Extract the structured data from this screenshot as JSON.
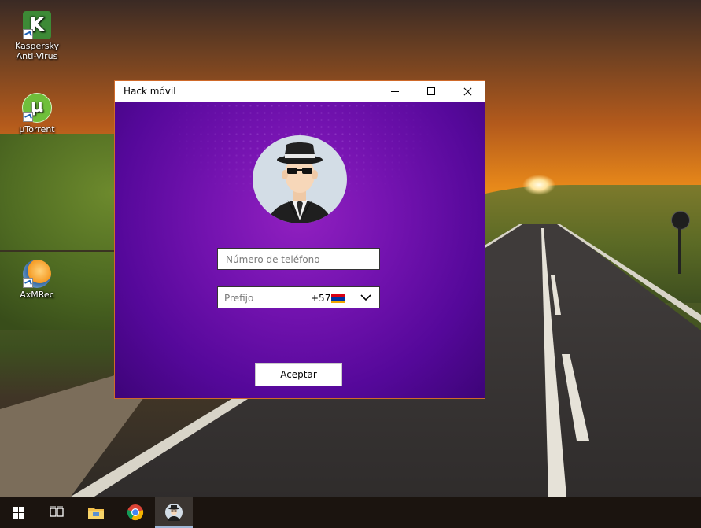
{
  "desktop": {
    "icons": [
      {
        "label": "Kaspersky Anti-Virus",
        "icon": "kaspersky-icon"
      },
      {
        "label": "µTorrent",
        "icon": "utorrent-icon"
      },
      {
        "label": "AxMRec",
        "icon": "axmrec-icon"
      }
    ]
  },
  "window": {
    "title": "Hack móvil",
    "controls": [
      "minimize-icon",
      "maximize-icon",
      "close-icon"
    ],
    "avatar": "spy-avatar-icon",
    "phone_placeholder": "Número de teléfono",
    "prefix_label": "Prefijo",
    "prefix_value": "+57",
    "prefix_flag": "flag-icon",
    "accept_label": "Aceptar"
  },
  "taskbar": {
    "items": [
      "start-windows-icon",
      "task-view-icon",
      "file-explorer-icon",
      "chrome-icon",
      "hack-movil-app-icon"
    ]
  },
  "colors": {
    "window_bg_center": "#9120c0",
    "window_bg_edge": "#3d0478",
    "window_border": "#d06a2a",
    "taskbar": "#1b140f"
  }
}
